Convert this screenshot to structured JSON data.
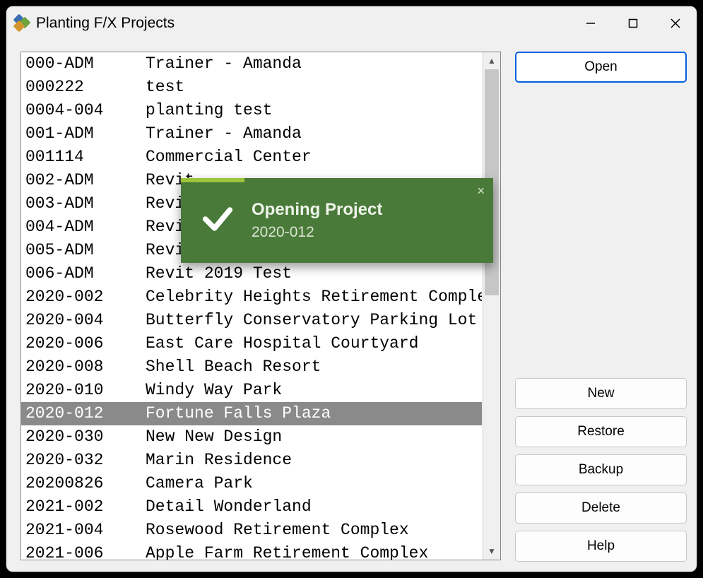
{
  "window": {
    "title": "Planting F/X Projects"
  },
  "buttons": {
    "open": "Open",
    "new": "New",
    "restore": "Restore",
    "backup": "Backup",
    "delete": "Delete",
    "help": "Help"
  },
  "toast": {
    "title": "Opening Project",
    "subtitle": "2020-012",
    "close": "×"
  },
  "selected_index": 15,
  "projects": [
    {
      "num": "000-ADM",
      "name": "Trainer - Amanda"
    },
    {
      "num": "000222",
      "name": "test"
    },
    {
      "num": "0004-004",
      "name": "planting test"
    },
    {
      "num": "001-ADM",
      "name": "Trainer - Amanda"
    },
    {
      "num": "001114",
      "name": "Commercial Center"
    },
    {
      "num": "002-ADM",
      "name": "Revit"
    },
    {
      "num": "003-ADM",
      "name": "Revit"
    },
    {
      "num": "004-ADM",
      "name": "Revit"
    },
    {
      "num": "005-ADM",
      "name": "Revit 2020 test"
    },
    {
      "num": "006-ADM",
      "name": "Revit 2019 Test"
    },
    {
      "num": "2020-002",
      "name": "Celebrity Heights Retirement Complex"
    },
    {
      "num": "2020-004",
      "name": "Butterfly Conservatory Parking Lot"
    },
    {
      "num": "2020-006",
      "name": "East Care Hospital Courtyard"
    },
    {
      "num": "2020-008",
      "name": "Shell Beach Resort"
    },
    {
      "num": "2020-010",
      "name": "Windy Way Park"
    },
    {
      "num": "2020-012",
      "name": "Fortune Falls Plaza"
    },
    {
      "num": "2020-030",
      "name": "New New Design"
    },
    {
      "num": "2020-032",
      "name": "Marin Residence"
    },
    {
      "num": "20200826",
      "name": "Camera Park"
    },
    {
      "num": "2021-002",
      "name": "Detail Wonderland"
    },
    {
      "num": "2021-004",
      "name": "Rosewood Retirement Complex"
    },
    {
      "num": "2021-006",
      "name": "Apple Farm Retirement Complex"
    }
  ]
}
